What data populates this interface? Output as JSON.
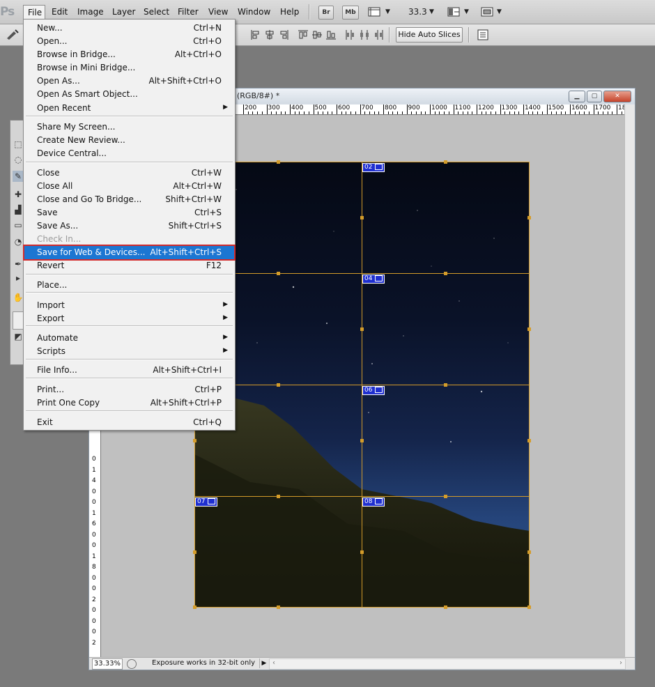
{
  "app": {
    "logo": "Ps"
  },
  "menubar": {
    "items": [
      "File",
      "Edit",
      "Image",
      "Layer",
      "Select",
      "Filter",
      "View",
      "Window",
      "Help"
    ],
    "bridge_button": "Br",
    "minibridge_button": "Mb",
    "zoom": "33.3"
  },
  "options_bar": {
    "hide_auto_slices": "Hide Auto Slices"
  },
  "document": {
    "title": "(RGB/8#) *",
    "ruler_labels": [
      "200",
      "300",
      "400",
      "500",
      "600",
      "700",
      "800",
      "900",
      "1000",
      "1100",
      "1200",
      "1300",
      "1400",
      "1500",
      "1600",
      "1700",
      "18"
    ],
    "vertical_ruler_digits": [
      "0",
      "1",
      "4",
      "0",
      "0",
      "1",
      "6",
      "0",
      "0",
      "1",
      "8",
      "0",
      "0",
      "2",
      "0",
      "0",
      "0",
      "2"
    ],
    "slice_tags": [
      "02",
      "04",
      "06",
      "07",
      "08"
    ],
    "status": {
      "zoom": "33.33%",
      "message": "Exposure works in 32-bit only"
    }
  },
  "file_menu": {
    "items": [
      {
        "label": "New...",
        "shortcut": "Ctrl+N"
      },
      {
        "label": "Open...",
        "shortcut": "Ctrl+O"
      },
      {
        "label": "Browse in Bridge...",
        "shortcut": "Alt+Ctrl+O"
      },
      {
        "label": "Browse in Mini Bridge...",
        "shortcut": ""
      },
      {
        "label": "Open As...",
        "shortcut": "Alt+Shift+Ctrl+O"
      },
      {
        "label": "Open As Smart Object...",
        "shortcut": ""
      },
      {
        "label": "Open Recent",
        "shortcut": ""
      },
      {
        "label": "Share My Screen...",
        "shortcut": ""
      },
      {
        "label": "Create New Review...",
        "shortcut": ""
      },
      {
        "label": "Device Central...",
        "shortcut": ""
      },
      {
        "label": "Close",
        "shortcut": "Ctrl+W"
      },
      {
        "label": "Close All",
        "shortcut": "Alt+Ctrl+W"
      },
      {
        "label": "Close and Go To Bridge...",
        "shortcut": "Shift+Ctrl+W"
      },
      {
        "label": "Save",
        "shortcut": "Ctrl+S"
      },
      {
        "label": "Save As...",
        "shortcut": "Shift+Ctrl+S"
      },
      {
        "label": "Check In...",
        "shortcut": ""
      },
      {
        "label": "Save for Web & Devices...",
        "shortcut": "Alt+Shift+Ctrl+S"
      },
      {
        "label": "Revert",
        "shortcut": "F12"
      },
      {
        "label": "Place...",
        "shortcut": ""
      },
      {
        "label": "Import",
        "shortcut": ""
      },
      {
        "label": "Export",
        "shortcut": ""
      },
      {
        "label": "Automate",
        "shortcut": ""
      },
      {
        "label": "Scripts",
        "shortcut": ""
      },
      {
        "label": "File Info...",
        "shortcut": "Alt+Shift+Ctrl+I"
      },
      {
        "label": "Print...",
        "shortcut": "Ctrl+P"
      },
      {
        "label": "Print One Copy",
        "shortcut": "Alt+Shift+Ctrl+P"
      },
      {
        "label": "Exit",
        "shortcut": "Ctrl+Q"
      }
    ]
  },
  "colors": {
    "highlight": "#1c76d2",
    "highlight_outline": "#d32a2a",
    "slice_line": "#d49c2a",
    "slice_tag": "#1f2fd0"
  }
}
